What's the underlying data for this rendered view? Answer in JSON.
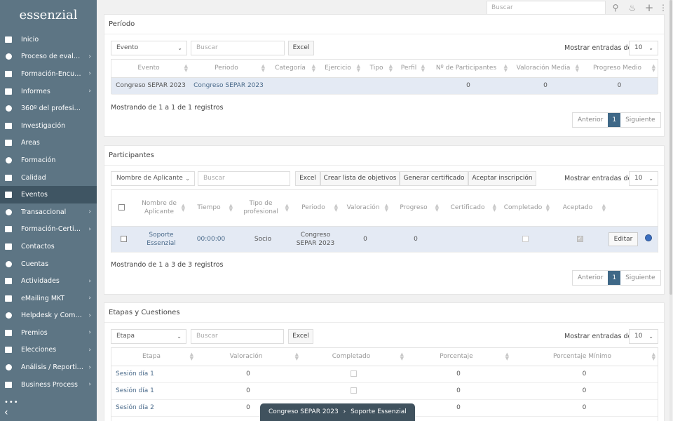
{
  "app": {
    "logo": "essenzial"
  },
  "sidebar": {
    "items": [
      {
        "label": "Inicio",
        "icon": "grid-icon",
        "arrow": false
      },
      {
        "label": "Proceso de evalua...",
        "icon": "gear-icon",
        "arrow": true
      },
      {
        "label": "Formación-Encues...",
        "icon": "clipboard-icon",
        "arrow": true
      },
      {
        "label": "Informes",
        "icon": "chart-icon",
        "arrow": true
      },
      {
        "label": "360º del profesional",
        "icon": "calendar-icon",
        "arrow": false
      },
      {
        "label": "Investigación",
        "icon": "flask-icon",
        "arrow": false
      },
      {
        "label": "Áreas",
        "icon": "picture-icon",
        "arrow": false
      },
      {
        "label": "Formación",
        "icon": "graduation-cap-icon",
        "arrow": false
      },
      {
        "label": "Calidad",
        "icon": "gear-icon",
        "arrow": false
      },
      {
        "label": "Eventos",
        "icon": "microphone-icon",
        "arrow": false,
        "active": true
      },
      {
        "label": "Transaccional",
        "icon": "graduation-cap-icon",
        "arrow": true
      },
      {
        "label": "Formación-Certific...",
        "icon": "presentation-icon",
        "arrow": true
      },
      {
        "label": "Contactos",
        "icon": "address-book-icon",
        "arrow": false
      },
      {
        "label": "Cuentas",
        "icon": "building-icon",
        "arrow": false
      },
      {
        "label": "Actividades",
        "icon": "calendar-check-icon",
        "arrow": true
      },
      {
        "label": "eMailing MKT",
        "icon": "volume-icon",
        "arrow": true
      },
      {
        "label": "Helpdesk y Comun...",
        "icon": "question-icon",
        "arrow": true
      },
      {
        "label": "Premios",
        "icon": "trophy-icon",
        "arrow": true
      },
      {
        "label": "Elecciones",
        "icon": "ballot-icon",
        "arrow": true
      },
      {
        "label": "Análisis / Reporting",
        "icon": "database-icon",
        "arrow": true
      },
      {
        "label": "Business Process",
        "icon": "cogs-icon",
        "arrow": true
      }
    ],
    "more": "•••",
    "collapse": "‹"
  },
  "topbar": {
    "search_placeholder": "Buscar"
  },
  "periodo": {
    "title": "Período",
    "filter_select": "Evento",
    "search_placeholder": "Buscar",
    "excel": "Excel",
    "show_entries_label": "Mostrar entradas de",
    "show_entries_value": "10",
    "columns": [
      "Evento",
      "Periodo",
      "Categoría",
      "Ejercicio",
      "Tipo",
      "Perfil",
      "Nº de Participantes",
      "Valoración Media",
      "Progreso Medio"
    ],
    "rows": [
      {
        "evento": "Congreso SEPAR 2023",
        "periodo": "Congreso SEPAR 2023",
        "categoria": "",
        "ejercicio": "",
        "tipo": "",
        "perfil": "",
        "participantes": "0",
        "valoracion": "0",
        "progreso": "0"
      }
    ],
    "info": "Mostrando de 1 a 1 de 1 registros",
    "pager": {
      "prev": "Anterior",
      "current": "1",
      "next": "Siguiente"
    }
  },
  "participantes": {
    "title": "Participantes",
    "filter_select": "Nombre de Aplicante",
    "search_placeholder": "Buscar",
    "buttons": {
      "excel": "Excel",
      "crear": "Crear lista de objetivos",
      "generar": "Generar certificado",
      "aceptar": "Aceptar inscripción"
    },
    "show_entries_label": "Mostrar entradas de",
    "show_entries_value": "10",
    "columns": {
      "nombre": "Nombre de Aplicante",
      "tiempo": "Tiempo",
      "tipo": "Tipo de profesional",
      "periodo": "Periodo",
      "valoracion": "Valoración",
      "progreso": "Progreso",
      "certificado": "Certificado",
      "completado": "Completado",
      "aceptado": "Aceptado"
    },
    "rows": [
      {
        "nombre": "Soporte Essenzial",
        "tiempo": "00:00:00",
        "tipo": "Socio",
        "periodo": "Congreso SEPAR 2023",
        "valoracion": "0",
        "progreso": "0",
        "edit": "Editar"
      }
    ],
    "info": "Mostrando de 1 a 3 de 3 registros",
    "pager": {
      "prev": "Anterior",
      "current": "1",
      "next": "Siguiente"
    }
  },
  "etapas": {
    "title": "Etapas y Cuestiones",
    "filter_select": "Etapa",
    "search_placeholder": "Buscar",
    "excel": "Excel",
    "show_entries_label": "Mostrar entradas de",
    "show_entries_value": "10",
    "columns": {
      "etapa": "Etapa",
      "valoracion": "Valoración",
      "completado": "Completado",
      "porcentaje": "Porcentaje",
      "minimo": "Porcentaje Mínimo"
    },
    "rows": [
      {
        "etapa": "Sesión día 1",
        "valoracion": "0",
        "porcentaje": "0",
        "minimo": "0"
      },
      {
        "etapa": "Sesión día 1",
        "valoracion": "0",
        "porcentaje": "0",
        "minimo": "0"
      },
      {
        "etapa": "Sesión día 2",
        "valoracion": "0",
        "porcentaje": "0",
        "minimo": "0"
      }
    ]
  },
  "breadcrumb": {
    "part1": "Congreso SEPAR 2023",
    "sep": "›",
    "part2": "Soporte Essenzial"
  }
}
